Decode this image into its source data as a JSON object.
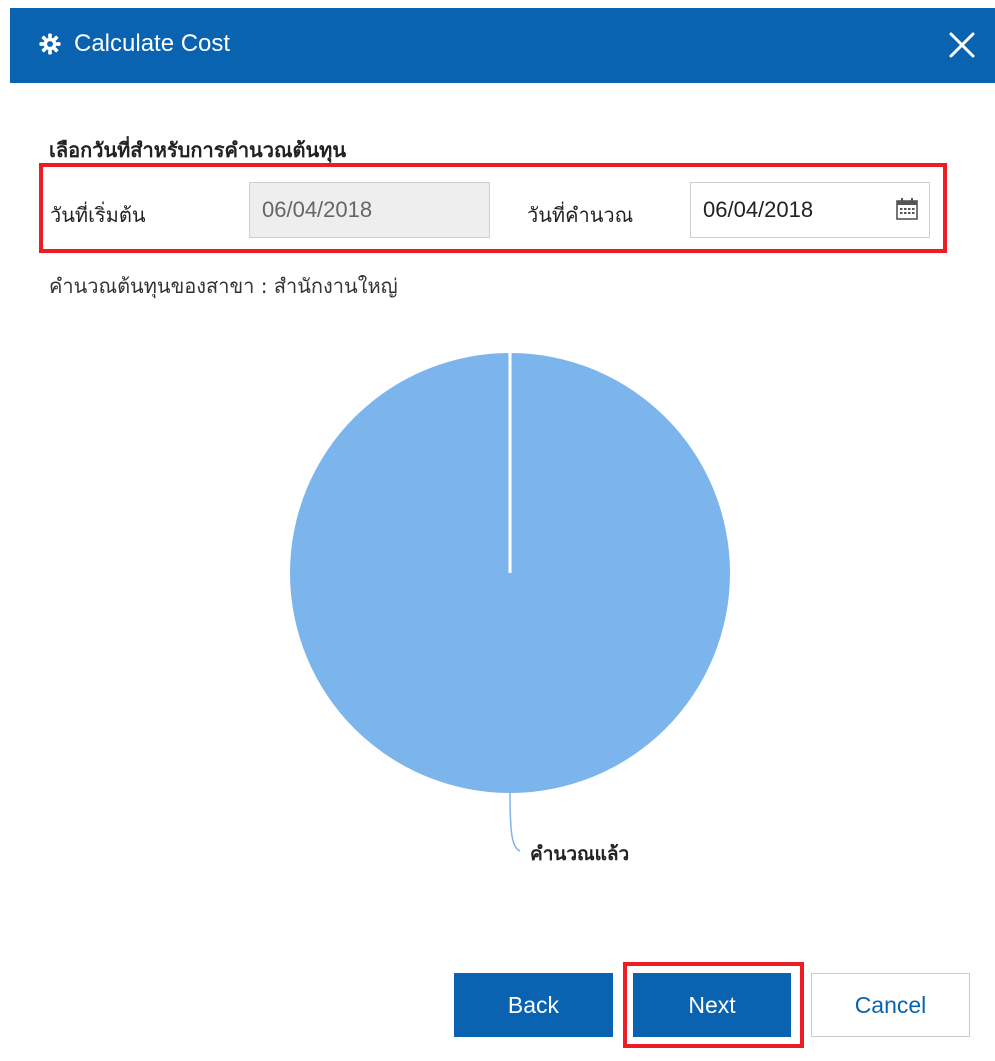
{
  "dialog": {
    "title": "Calculate Cost",
    "icon": "gear-icon",
    "close_icon": "close-icon"
  },
  "form": {
    "section_title": "เลือกวันที่สำหรับการคำนวณต้นทุน",
    "start_date_label": "วันที่เริ่มต้น",
    "start_date_value": "06/04/2018",
    "calc_date_label": "วันที่คำนวณ",
    "calc_date_value": "06/04/2018",
    "calendar_icon": "calendar-icon"
  },
  "branch_text": "คำนวณต้นทุนของสาขา : สำนักงานใหญ่",
  "chart_data": {
    "type": "pie",
    "slices": [
      {
        "label": "คำนวณแล้ว",
        "value": 100,
        "color": "#7cb5ec"
      }
    ]
  },
  "buttons": {
    "back": "Back",
    "next": "Next",
    "cancel": "Cancel"
  },
  "colors": {
    "header": "#0a63b0",
    "highlight": "#ee1c24",
    "pie": "#7cb5ec"
  }
}
